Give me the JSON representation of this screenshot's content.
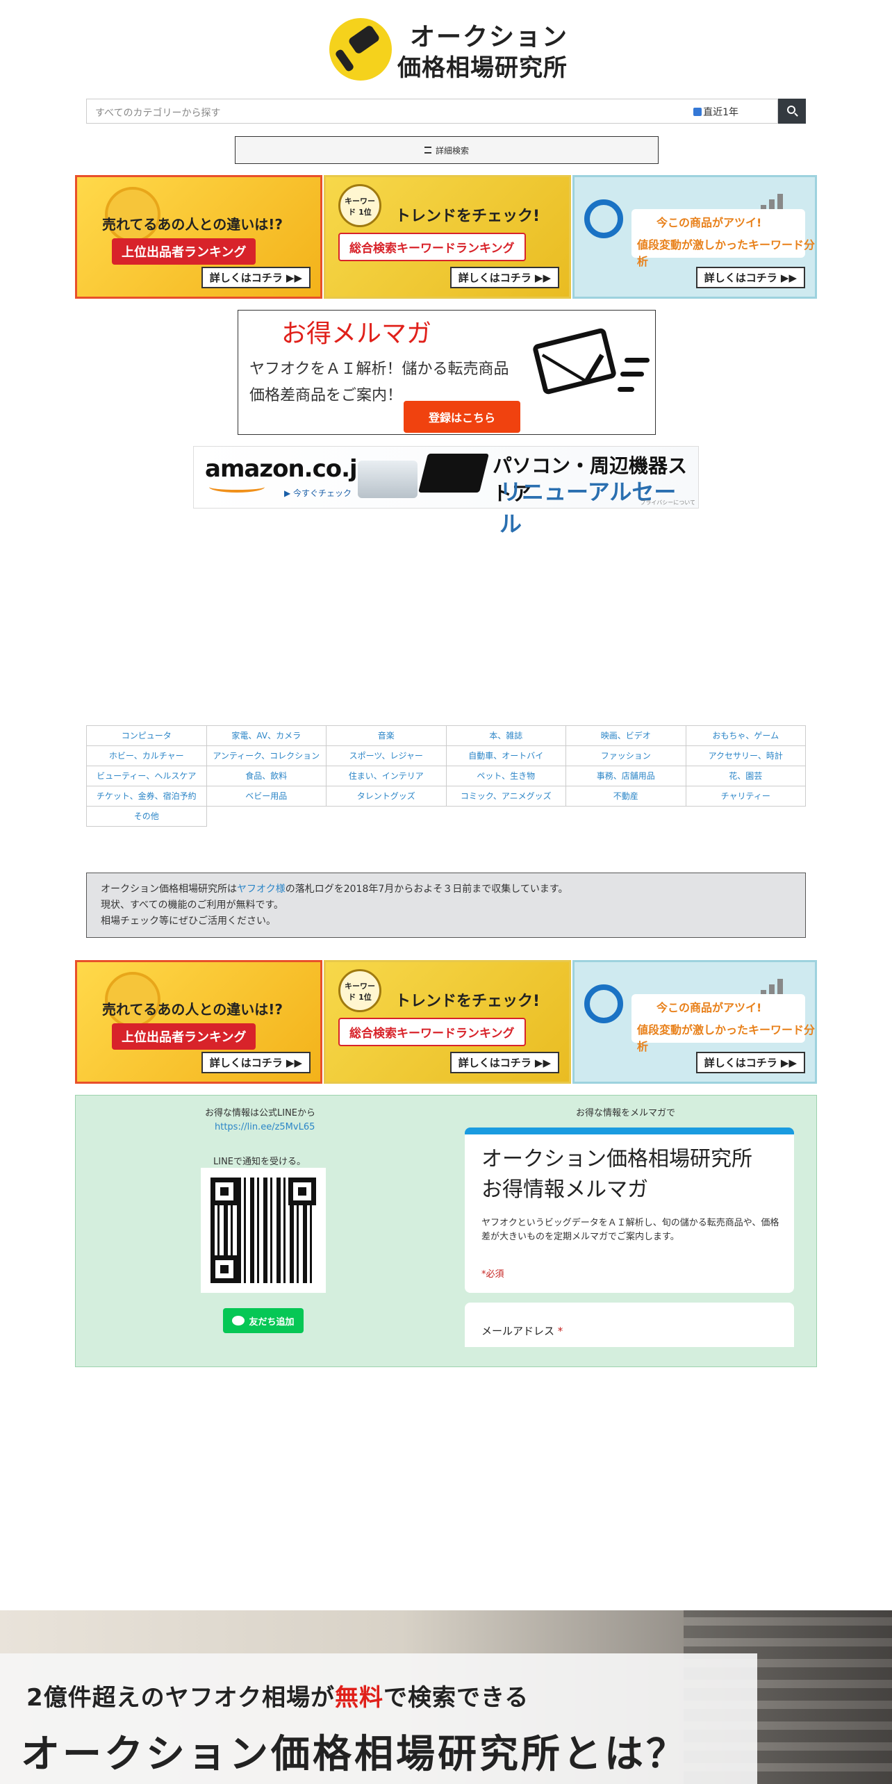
{
  "header": {
    "logo_line1": "オークション",
    "logo_line2": "価格相場研究所"
  },
  "search": {
    "placeholder": "すべてのカテゴリーから探す",
    "checkbox_label": "直近1年",
    "advanced_label": "詳細検索"
  },
  "banners": [
    {
      "title": "売れてるあの人との違いは!?",
      "pill": "上位出品者ランキング",
      "more": "詳しくはコチラ ▶▶",
      "color": "#e8502a"
    },
    {
      "badge": "キーワード 1位",
      "title": "トレンドをチェック!",
      "pill": "総合検索キーワードランキング",
      "more": "詳しくはコチラ ▶▶",
      "color": "#d4a514"
    },
    {
      "title": "今この商品がアツイ!",
      "pill": "値段変動が激しかったキーワード分析",
      "more": "詳しくはコチラ ▶▶",
      "color": "#2a78c8"
    }
  ],
  "mail_ad": {
    "title": "お得メルマガ",
    "line1": "ヤフオクをＡＩ解析！儲かる転売商品",
    "line2": "価格差商品をご案内！",
    "button": "登録はこちら"
  },
  "amazon_ad": {
    "logo": "amazon.co.jp",
    "check": "▶ 今すぐチェック",
    "line1": "パソコン・周辺機器ストア",
    "line2": "リニューアルセール",
    "privacy": "プライバシーについて"
  },
  "categories": [
    [
      "コンピュータ",
      "家電、AV、カメラ",
      "音楽",
      "本、雑誌",
      "映画、ビデオ",
      "おもちゃ、ゲーム"
    ],
    [
      "ホビー、カルチャー",
      "アンティーク、コレクション",
      "スポーツ、レジャー",
      "自動車、オートバイ",
      "ファッション",
      "アクセサリー、時計"
    ],
    [
      "ビューティー、ヘルスケア",
      "食品、飲料",
      "住まい、インテリア",
      "ペット、生き物",
      "事務、店舗用品",
      "花、園芸"
    ],
    [
      "チケット、金券、宿泊予約",
      "ベビー用品",
      "タレントグッズ",
      "コミック、アニメグッズ",
      "不動産",
      "チャリティー"
    ],
    [
      "その他"
    ]
  ],
  "info": {
    "pre": "オークション価格相場研究所は",
    "link": "ヤフオク様",
    "post": "の落札ログを2018年7月からおよそ３日前まで収集しています。",
    "line2": "現状、すべての機能のご利用が無料です。",
    "line3": "相場チェック等にぜひご活用ください。"
  },
  "line_section": {
    "title": "お得な情報は公式LINEから",
    "url": "https://lin.ee/z5MvL65",
    "notify": "LINEで通知を受ける。",
    "button": "友だち追加"
  },
  "mail_section": {
    "title": "お得な情報をメルマガで",
    "card_title": "オークション価格相場研究所　お得情報メルマガ",
    "card_desc": "ヤフオクというビッグデータをＡＩ解析し、旬の儲かる転売商品や、価格差が大きいものを定期メルマガでご案内します。",
    "required": "*必須",
    "email_label": "メールアドレス",
    "email_star": "*"
  },
  "hero": {
    "sub_pre": "2億件超えのヤフオク相場が",
    "sub_red": "無料",
    "sub_post": "で検索できる",
    "main": "オークション価格相場研究所とは？"
  }
}
